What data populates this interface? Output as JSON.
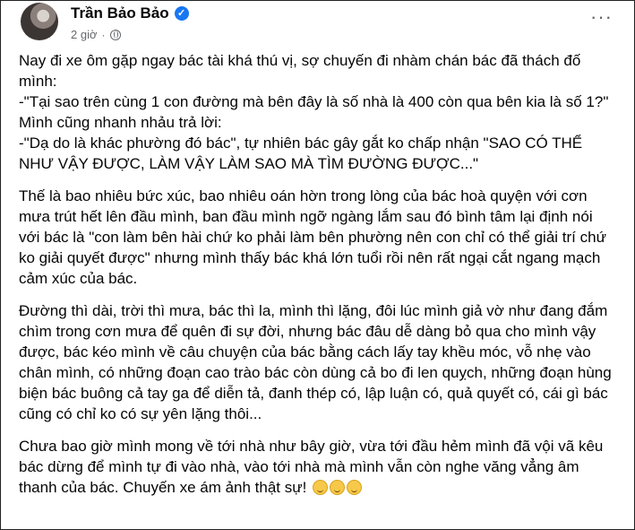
{
  "post": {
    "author": "Trần Bảo Bảo",
    "time": "2 giờ",
    "separator": "·",
    "paragraphs": [
      [
        "Nay đi xe ôm gặp ngay bác tài khá thú vị, sợ chuyến đi nhàm chán bác đã thách đố mình:",
        "-\"Tại sao trên cùng 1 con đường mà bên đây là số nhà là 400 còn qua bên kia là số 1?\"",
        "Mình cũng nhanh nhảu trả lời:",
        "-\"Dạ do là khác phường đó bác\", tự nhiên bác gây gắt ko chấp nhận \"SAO CÓ THỂ NHƯ VẬY ĐƯỢC, LÀM VẬY LÀM SAO MÀ TÌM ĐƯỜNG ĐƯỢC...\""
      ],
      [
        "Thế là bao nhiêu bức xúc, bao nhiêu oán hờn trong lòng của bác hoà quyện với cơn mưa trút hết lên đầu mình, ban đầu mình ngỡ ngàng lắm sau đó bình tâm lại định nói với bác là \"con làm bên hài chứ ko phải làm bên phường nên con chỉ có thể giải trí chứ ko giải quyết được\" nhưng mình thấy bác khá lớn tuổi rồi nên rất ngại cắt ngang mạch cảm xúc của bác."
      ],
      [
        "Đường thì dài, trời thì mưa, bác thì la, mình thì lặng, đôi lúc mình giả vờ như đang đắm chìm trong cơn mưa để quên đi sự đời, nhưng bác đâu dễ dàng bỏ qua cho mình vậy được, bác kéo mình về câu chuyện của bác bằng cách lấy tay khều móc, vỗ nhẹ vào chân mình, có những đoạn cao trào bác còn dùng cả bo đi len quỵch, những đoạn hùng biện bác buông cả tay ga để diễn tả, đanh thép có, lập luận có, quả quyết có, cái gì bác cũng có chỉ ko có sự yên lặng thôi..."
      ],
      [
        "Chưa bao giờ mình mong về tới nhà như bây giờ, vừa tới đầu hẻm mình đã vội vã kêu bác dừng để mình tự đi vào nhà, vào tới nhà mà mình vẫn còn nghe văng vẳng âm thanh của bác. Chuyến xe ám ảnh thật sự!"
      ]
    ]
  },
  "icons": {
    "verified": "verified-badge-icon",
    "privacy": "globe-icon",
    "more": "more-options-icon",
    "emoji": "sad-smile-emoji-icon"
  },
  "colors": {
    "verified": "#1877f2",
    "meta": "#65676b",
    "text": "#050505"
  }
}
